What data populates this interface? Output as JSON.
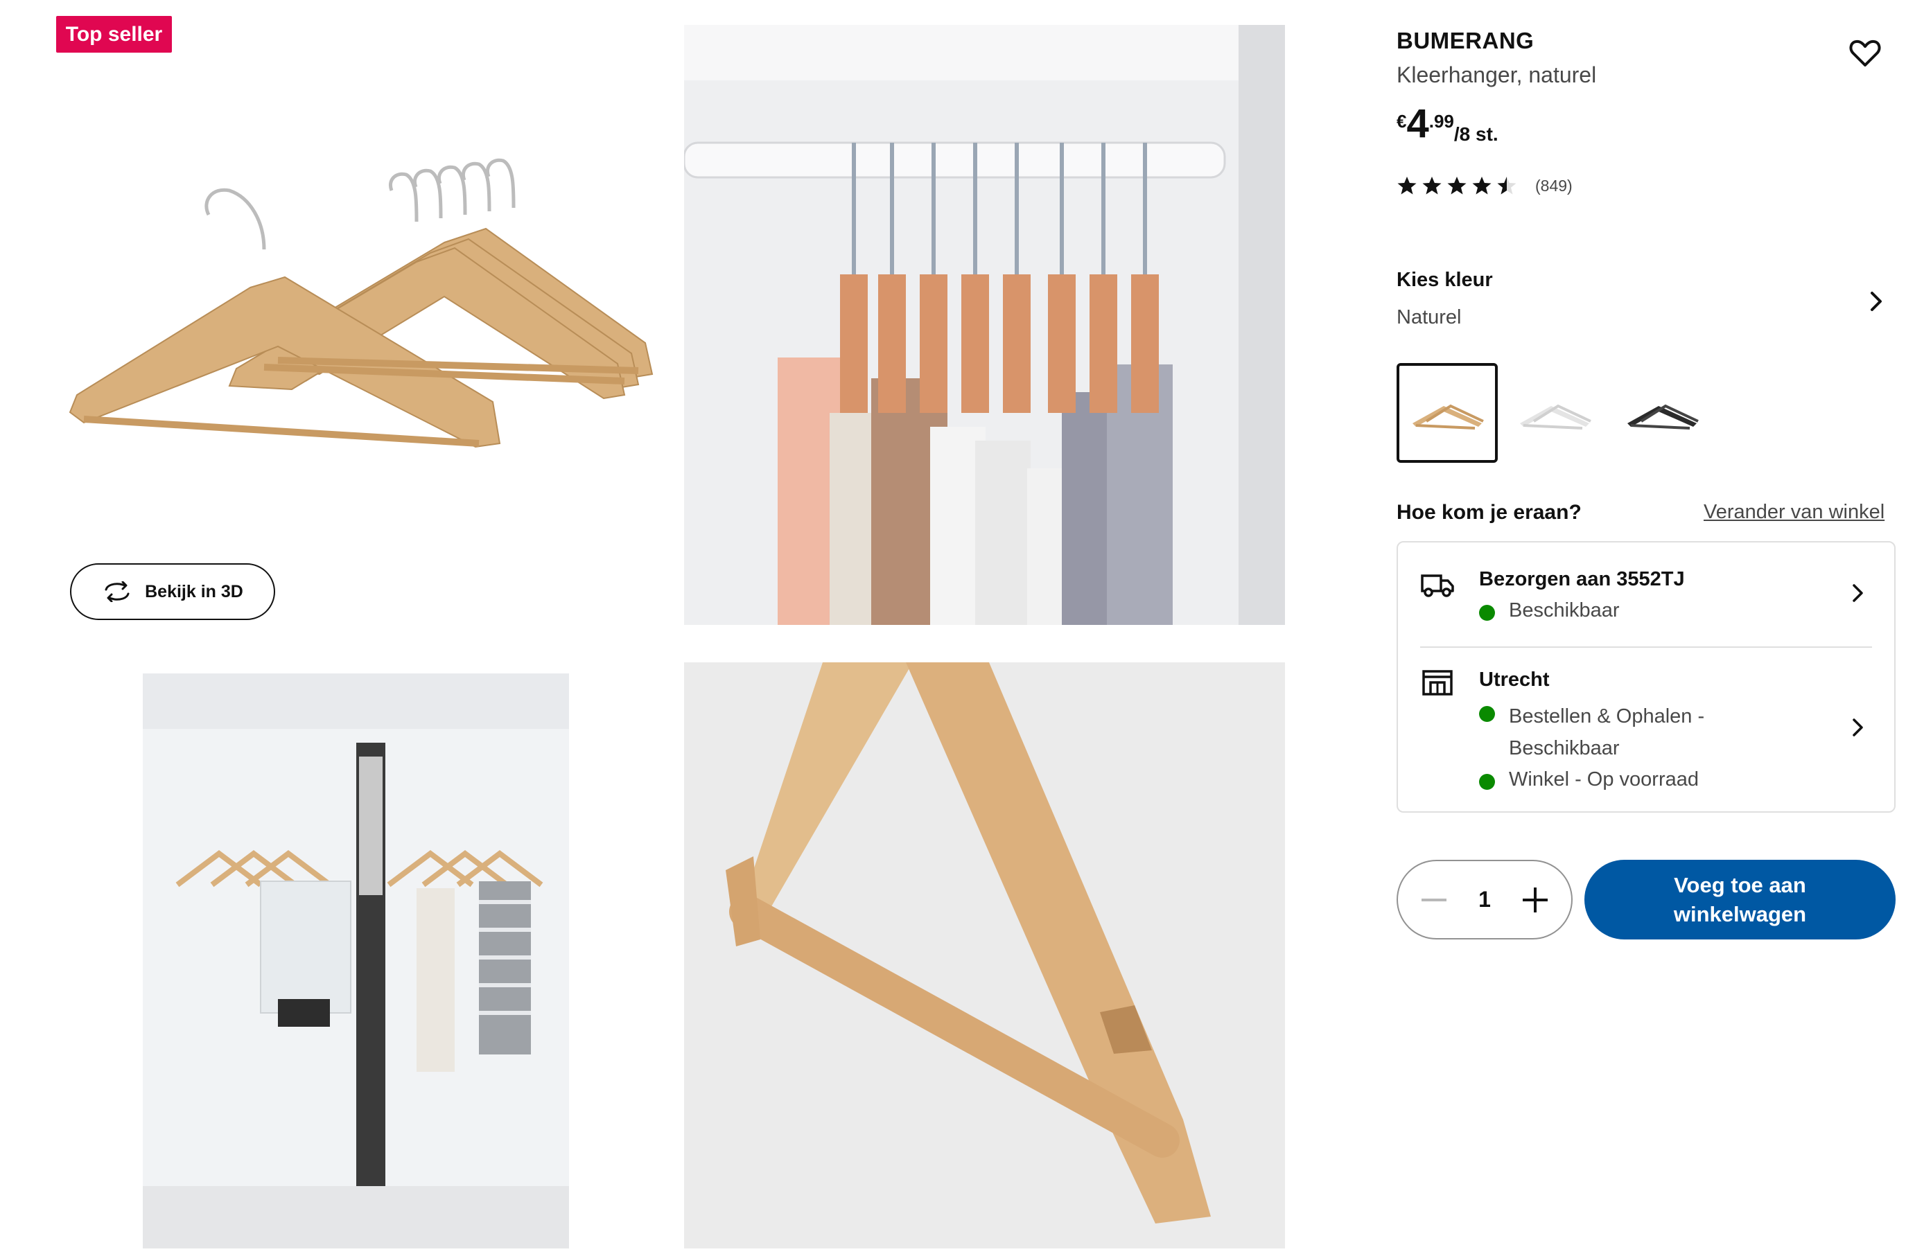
{
  "gallery": {
    "badge": "Top seller",
    "view3d_label": "Bekijk in 3D"
  },
  "product": {
    "name": "BUMERANG",
    "description": "Kleerhanger, naturel",
    "price": {
      "currency": "€",
      "integer": "4",
      "decimals": ".99",
      "unit": "/8 st."
    },
    "rating": {
      "stars": 4.5,
      "count": "(849)"
    }
  },
  "color": {
    "label": "Kies kleur",
    "selected": "Naturel",
    "swatches": [
      {
        "name": "naturel",
        "color": "#d9b07c"
      },
      {
        "name": "wit",
        "color": "#e4e4e4"
      },
      {
        "name": "zwart",
        "color": "#2b2b2b"
      }
    ]
  },
  "availability": {
    "heading": "Hoe kom je eraan?",
    "change_store": "Verander van winkel",
    "delivery": {
      "title": "Bezorgen aan 3552TJ",
      "status": "Beschikbaar"
    },
    "store": {
      "title": "Utrecht",
      "status1": "Bestellen & Ophalen - Beschikbaar",
      "status2": "Winkel - Op voorraad"
    }
  },
  "cart": {
    "quantity": "1",
    "add_label": "Voeg toe aan winkelwagen"
  },
  "colors": {
    "badge": "#e00751",
    "primary_button": "#0058a3",
    "available_dot": "#0a8a00"
  }
}
